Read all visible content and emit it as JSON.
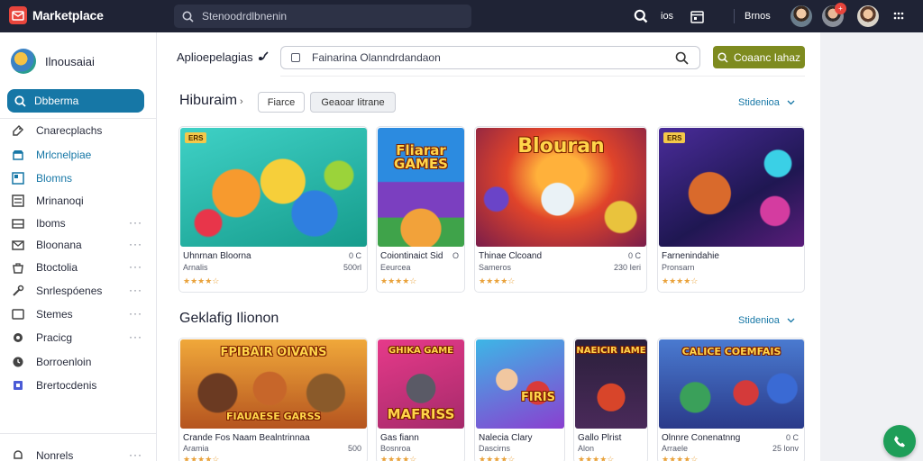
{
  "topbar": {
    "brand": "Marketplace",
    "search_placeholder": "Stenoodrdlbnenin",
    "count_label": "ios",
    "user_label": "Brnos"
  },
  "sidebar": {
    "user_name": "Ilnousaiai",
    "search_label": "Dbberma",
    "items": [
      {
        "label": "Cnarecplachs",
        "icon": "tag-icon",
        "dots": ""
      },
      {
        "label": "Mrlcnelpiae",
        "icon": "storefront-icon",
        "dots": ""
      },
      {
        "label": "Blomns",
        "icon": "grid-icon",
        "dots": ""
      },
      {
        "label": "Mrinanoqi",
        "icon": "list-icon",
        "dots": ""
      },
      {
        "label": "Iboms",
        "icon": "inbox-icon",
        "dots": "···"
      },
      {
        "label": "Bloonana",
        "icon": "mail-icon",
        "dots": "···"
      },
      {
        "label": "Btoctolia",
        "icon": "bag-icon",
        "dots": "···"
      },
      {
        "label": "Snrlespóenes",
        "icon": "tools-icon",
        "dots": "···"
      },
      {
        "label": "Stemes",
        "icon": "window-icon",
        "dots": "···"
      },
      {
        "label": "Pracicg",
        "icon": "pin-icon",
        "dots": "···"
      },
      {
        "label": "Borroenloin",
        "icon": "clock-icon",
        "dots": ""
      },
      {
        "label": "Brertocdenis",
        "icon": "flag-icon",
        "dots": ""
      },
      {
        "label": "Nonrels",
        "icon": "bell-icon",
        "dots": "···"
      }
    ]
  },
  "main": {
    "title": "Aplioepelagias",
    "search_placeholder": "Fainarina Olanndrdandaon",
    "cta_label": "Coaanc Iahaz",
    "section1": {
      "title": "Hiburaim",
      "arrow": "›",
      "chip_1": "Fiarce",
      "chip_2": "Geaoar Iitrane",
      "see_all": "Stidenioa",
      "cards": [
        {
          "thumb_badge": "ERS",
          "thumb_text": "",
          "title": "Uhnrnan Bloorna",
          "sub": "Arnalis",
          "meta1": "0 C",
          "meta2": "500rl",
          "stars": "★★★★☆"
        },
        {
          "thumb_badge": "",
          "thumb_text": "Fliarar GAMES",
          "title": "Coiontinaict Sid",
          "sub": "Eeurcea",
          "meta1": "O",
          "meta2": "",
          "stars": "★★★★☆"
        },
        {
          "thumb_badge": "",
          "thumb_text": "Blouran",
          "title": "Thinae Clcoand",
          "sub": "Sameros",
          "meta1": "0 C",
          "meta2": "230 Ieri",
          "stars": "★★★★☆"
        },
        {
          "thumb_badge": "ERS",
          "thumb_text": "",
          "title": "Farnenindahie",
          "sub": "Pronsarn",
          "meta1": "",
          "meta2": "",
          "stars": "★★★★☆"
        }
      ]
    },
    "section2": {
      "title": "Geklafig Ilionon",
      "see_all": "Stidenioa",
      "cards": [
        {
          "thumb_text": "FPIBAIR  OIVANS",
          "thumb_text2": "FIAUAESE   GARSS",
          "title": "Crande Fos Naam Bealntrinnaa",
          "sub": "Aramia",
          "meta1": "500",
          "meta2": "",
          "stars": "★★★★☆"
        },
        {
          "thumb_text": "GHIKA GAME",
          "thumb_text2": "MAFRISS",
          "title": "Gas fiann",
          "sub": "Bosnroa",
          "meta1": "",
          "meta2": "",
          "stars": "★★★★☆"
        },
        {
          "thumb_text": "",
          "thumb_text2": "FIRIS",
          "title": "Nalecia Clary",
          "sub": "Dascirns",
          "meta1": "",
          "meta2": "",
          "stars": "★★★★☆"
        },
        {
          "thumb_text": "NAEICIR IAME",
          "thumb_text2": "",
          "title": "Gallo Plrist",
          "sub": "Alon",
          "meta1": "",
          "meta2": "",
          "stars": "★★★★☆"
        },
        {
          "thumb_text": "CALICE  COEMFAIS",
          "thumb_text2": "",
          "title": "Olnnre Conenatnng",
          "sub": "Arraele",
          "meta1": "0 C",
          "meta2": "25 lonv",
          "stars": "★★★★☆"
        }
      ]
    }
  }
}
